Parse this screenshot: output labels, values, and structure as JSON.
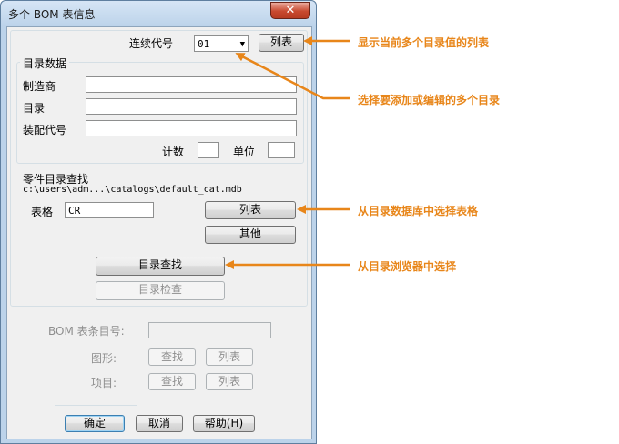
{
  "window": {
    "title": "多个 BOM 表信息",
    "close_glyph": "✕"
  },
  "top": {
    "sequence_label": "连续代号",
    "sequence_value": "01",
    "list_button": "列表"
  },
  "catalog_data": {
    "group_title": "目录数据",
    "manufacturer_label": "制造商",
    "manufacturer_value": "",
    "catalog_label": "目录",
    "catalog_value": "",
    "assembly_label": "装配代号",
    "assembly_value": "",
    "count_label": "计数",
    "count_value": "",
    "unit_label": "单位",
    "unit_value": ""
  },
  "parts_lookup": {
    "title": "零件目录查找",
    "path": "c:\\users\\adm...\\catalogs\\default_cat.mdb",
    "table_label": "表格",
    "table_value": "CR",
    "list_button": "列表",
    "other_button": "其他",
    "lookup_button": "目录查找",
    "check_button": "目录检查"
  },
  "bom": {
    "item_label": "BOM 表条目号:",
    "item_value": "",
    "drawing_label": "图形:",
    "project_label": "项目:",
    "find_button": "查找",
    "list_button": "列表"
  },
  "footer": {
    "ok_button": "确定",
    "cancel_button": "取消",
    "help_button": "帮助(H)"
  },
  "callouts": {
    "show_list": "显示当前多个目录值的列表",
    "select_multi": "选择要添加或编辑的多个目录",
    "select_table": "从目录数据库中选择表格",
    "select_browser": "从目录浏览器中选择"
  },
  "colors": {
    "accent": "#e8861a",
    "window_frame": "#bcd3ea",
    "close_button": "#c8492f"
  }
}
